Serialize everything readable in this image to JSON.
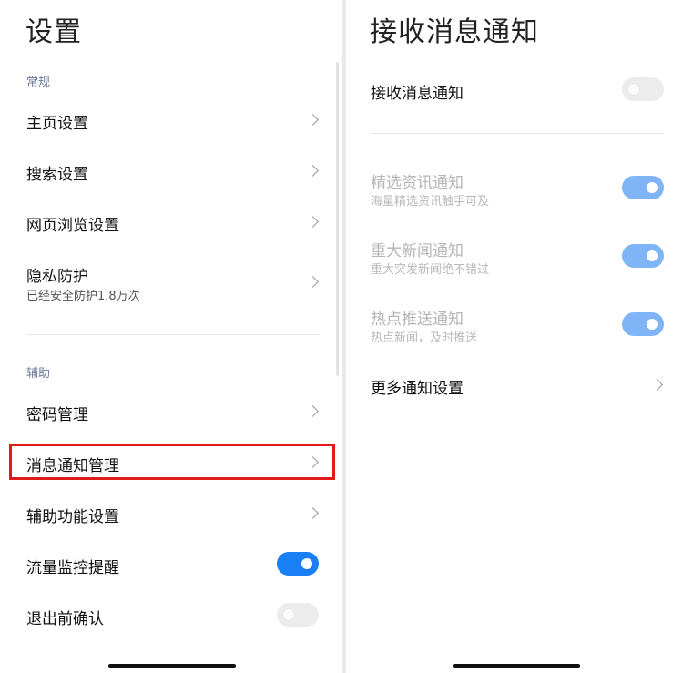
{
  "settings": {
    "title": "设置",
    "section_general": "常规",
    "section_assist": "辅助",
    "items": [
      {
        "label": "主页设置"
      },
      {
        "label": "搜索设置"
      },
      {
        "label": "网页浏览设置"
      },
      {
        "label": "隐私防护",
        "subtitle": "已经安全防护1.8万次"
      },
      {
        "label": "密码管理"
      },
      {
        "label": "消息通知管理"
      },
      {
        "label": "辅助功能设置"
      },
      {
        "label": "流量监控提醒",
        "toggle": "on"
      },
      {
        "label": "退出前确认",
        "toggle": "off"
      }
    ]
  },
  "notifications": {
    "title": "接收消息通知",
    "master": {
      "label": "接收消息通知",
      "toggle": "off"
    },
    "items": [
      {
        "label": "精选资讯通知",
        "subtitle": "海量精选资讯触手可及",
        "toggle": "on"
      },
      {
        "label": "重大新闻通知",
        "subtitle": "重大突发新闻绝不错过",
        "toggle": "on"
      },
      {
        "label": "热点推送通知",
        "subtitle": "热点新闻，及时推送",
        "toggle": "on"
      }
    ],
    "more": {
      "label": "更多通知设置"
    }
  },
  "colors": {
    "accent": "#1a7ef5",
    "highlight": "#e01919",
    "section_label": "#6b7a99"
  },
  "icons": {
    "chevron": "chevron-right-icon"
  }
}
